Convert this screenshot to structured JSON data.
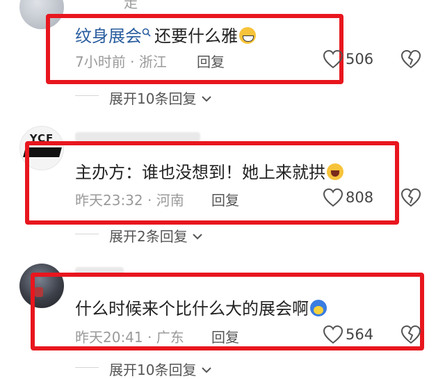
{
  "comments": [
    {
      "name_partial": "走",
      "content_link": "纹身展会",
      "content_rest": "还要什么雅",
      "time": "7小时前",
      "location": "浙江",
      "reply_label": "回复",
      "likes": "506",
      "expand_label": "展开10条回复"
    },
    {
      "avatar_text": "YCF",
      "content": "主办方：谁也没想到！她上来就拱",
      "time": "昨天23:32",
      "location": "河南",
      "reply_label": "回复",
      "likes": "808",
      "expand_label": "展开2条回复"
    },
    {
      "content": "什么时候来个比什么大的展会啊",
      "time": "昨天20:41",
      "location": "广东",
      "reply_label": "回复",
      "likes": "564",
      "expand_label": "展开10条回复"
    }
  ],
  "colors": {
    "highlight_box": "#e8161e",
    "link": "#2a5d9f",
    "meta": "#9a9a9a"
  },
  "icons": [
    "heart-icon",
    "broken-heart-icon",
    "search-icon",
    "chevron-down-icon"
  ]
}
